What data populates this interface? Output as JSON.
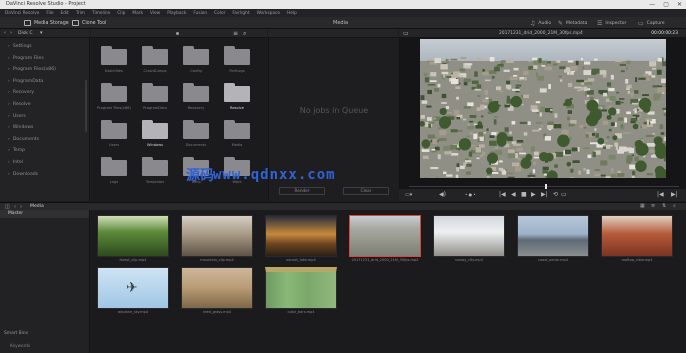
{
  "window": {
    "title": "DaVinci Resolve Studio - Project"
  },
  "menu": [
    "DaVinci Resolve",
    "File",
    "Edit",
    "Trim",
    "Timeline",
    "Clip",
    "Mark",
    "View",
    "Playback",
    "Fusion",
    "Color",
    "Fairlight",
    "Workspace",
    "Help"
  ],
  "toolbar": {
    "media_storage": "Media Storage",
    "clone_tool": "Clone Tool",
    "center_title": "Media",
    "right": [
      "Audio",
      "Metadata",
      "Inspector",
      "Capture"
    ]
  },
  "headers": {
    "drive": "Disk C",
    "viewer_clip": "20171231_drid_2000_21M_30fps.mp4",
    "timecode": "00:00:00:23"
  },
  "sidebar": [
    "Settings",
    "Program Files",
    "Program Files(x86)",
    "ProgramData",
    "Recovery",
    "Resolve",
    "Users",
    "Windows",
    "Documents",
    "Temp",
    "Intel",
    "Downloads"
  ],
  "folders": [
    "Batchfiles",
    "CrashDumps",
    "Config",
    "PerfLogs",
    "Program Files(x86)",
    "ProgramData",
    "Recovery",
    "Resolve",
    "Users",
    "Windows",
    "Documents",
    "Media",
    "Logs",
    "Templates",
    "Temp",
    "Work"
  ],
  "queue": {
    "no_jobs": "No jobs in Queue",
    "render_btn": "Render",
    "clear_btn": "Clear"
  },
  "media_pool": {
    "title": "Media",
    "sidebar_item": "Master",
    "bottom_label": "Smart Bins",
    "bottom_item": "Keywords"
  },
  "clips": [
    {
      "name": "forest_clip.mp4",
      "kind": "forest"
    },
    {
      "name": "mountain_clip.mp4",
      "kind": "mountain"
    },
    {
      "name": "sunset_lake.mp4",
      "kind": "sunset"
    },
    {
      "name": "20171231_drid_2000_21M_30fps.mp4",
      "kind": "city"
    },
    {
      "name": "snowy_city.mp4",
      "kind": "snow"
    },
    {
      "name": "coast_aerial.mp4",
      "kind": "coast"
    },
    {
      "name": "rooftop_view.mp4",
      "kind": "roof"
    },
    {
      "name": "airplane_sky.mp4",
      "kind": "plane"
    },
    {
      "name": "reed_grass.mp4",
      "kind": "grass"
    },
    {
      "name": "color_bars.mp4",
      "kind": "bars"
    }
  ],
  "watermark": {
    "cn": "源码",
    "url": "www.qdnxx.com"
  },
  "colors": {
    "accent_red": "#e0453b",
    "panel": "#1d1d1f",
    "watermark": "#2f63d8"
  }
}
